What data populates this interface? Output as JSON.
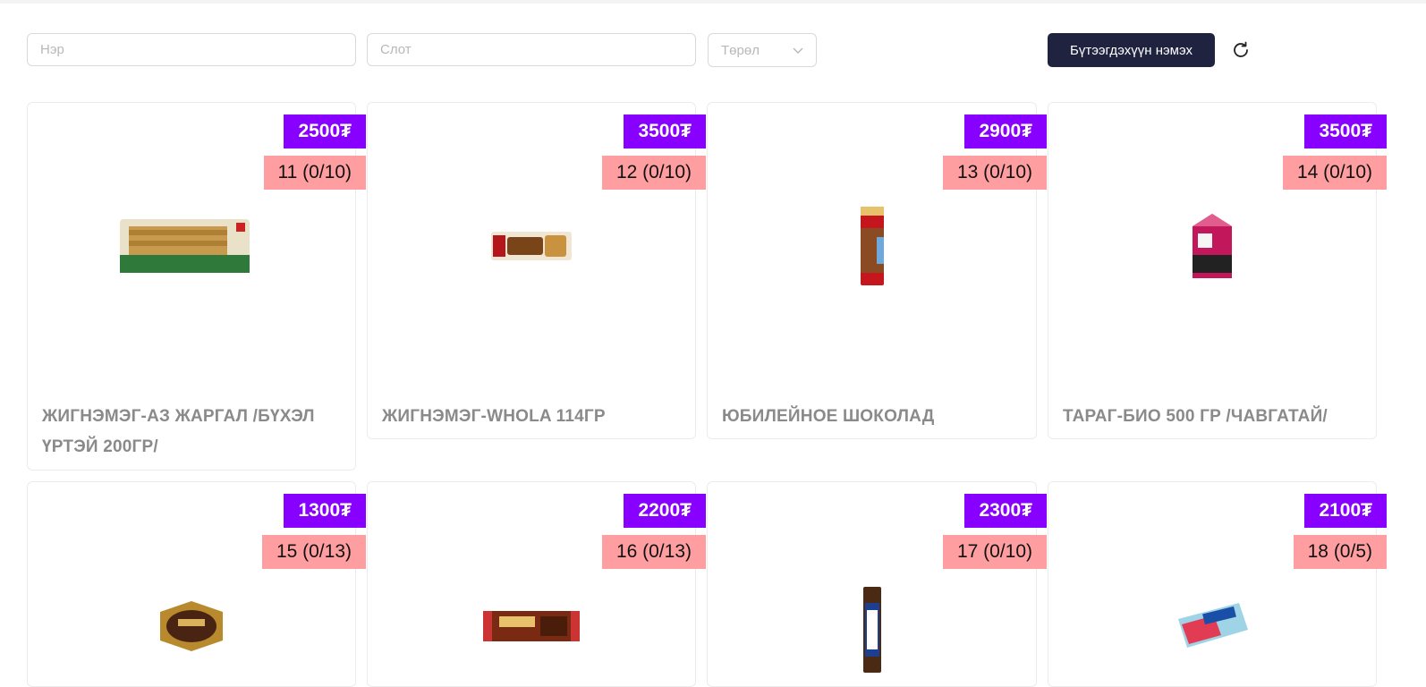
{
  "toolbar": {
    "name_placeholder": "Нэр",
    "slot_placeholder": "Слот",
    "type_placeholder": "Төрөл",
    "add_button": "Бүтээгдэхүүн нэмэх"
  },
  "colors": {
    "price_badge": "#8800ff",
    "slot_badge": "#ff9ea0",
    "primary_button": "#1f2340",
    "product_name": "#8a8a8a"
  },
  "products": [
    {
      "price": "2500₮",
      "slot": "11 (0/10)",
      "name": "ЖИГНЭМЭГ-АЗ ЖАРГАЛ /БҮХЭЛ ҮРТЭЙ 200ГР/"
    },
    {
      "price": "3500₮",
      "slot": "12 (0/10)",
      "name": "ЖИГНЭМЭГ-WHOLA 114ГР"
    },
    {
      "price": "2900₮",
      "slot": "13 (0/10)",
      "name": "ЮБИЛЕЙНОЕ ШОКОЛАД"
    },
    {
      "price": "3500₮",
      "slot": "14 (0/10)",
      "name": "ТАРАГ-БИО 500 ГР /ЧАВГАТАЙ/"
    },
    {
      "price": "1300₮",
      "slot": "15 (0/13)",
      "name": ""
    },
    {
      "price": "2200₮",
      "slot": "16 (0/13)",
      "name": ""
    },
    {
      "price": "2300₮",
      "slot": "17 (0/10)",
      "name": ""
    },
    {
      "price": "2100₮",
      "slot": "18 (0/5)",
      "name": ""
    }
  ]
}
